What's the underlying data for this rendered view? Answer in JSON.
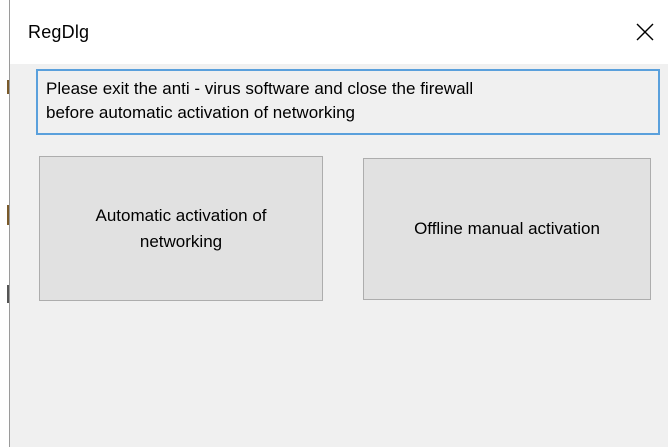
{
  "window": {
    "title": "RegDlg",
    "close_icon": "close-icon"
  },
  "message": {
    "line1": "Please exit the anti - virus software and close the firewall",
    "line2": "before automatic activation of networking"
  },
  "buttons": {
    "auto_activation_label_line1": "Automatic activation of",
    "auto_activation_label_line2": "networking",
    "offline_activation_label": "Offline manual activation"
  },
  "colors": {
    "focus_border": "#5aa0dc",
    "dialog_bg": "#f0f0f0",
    "button_bg": "#e1e1e1"
  }
}
